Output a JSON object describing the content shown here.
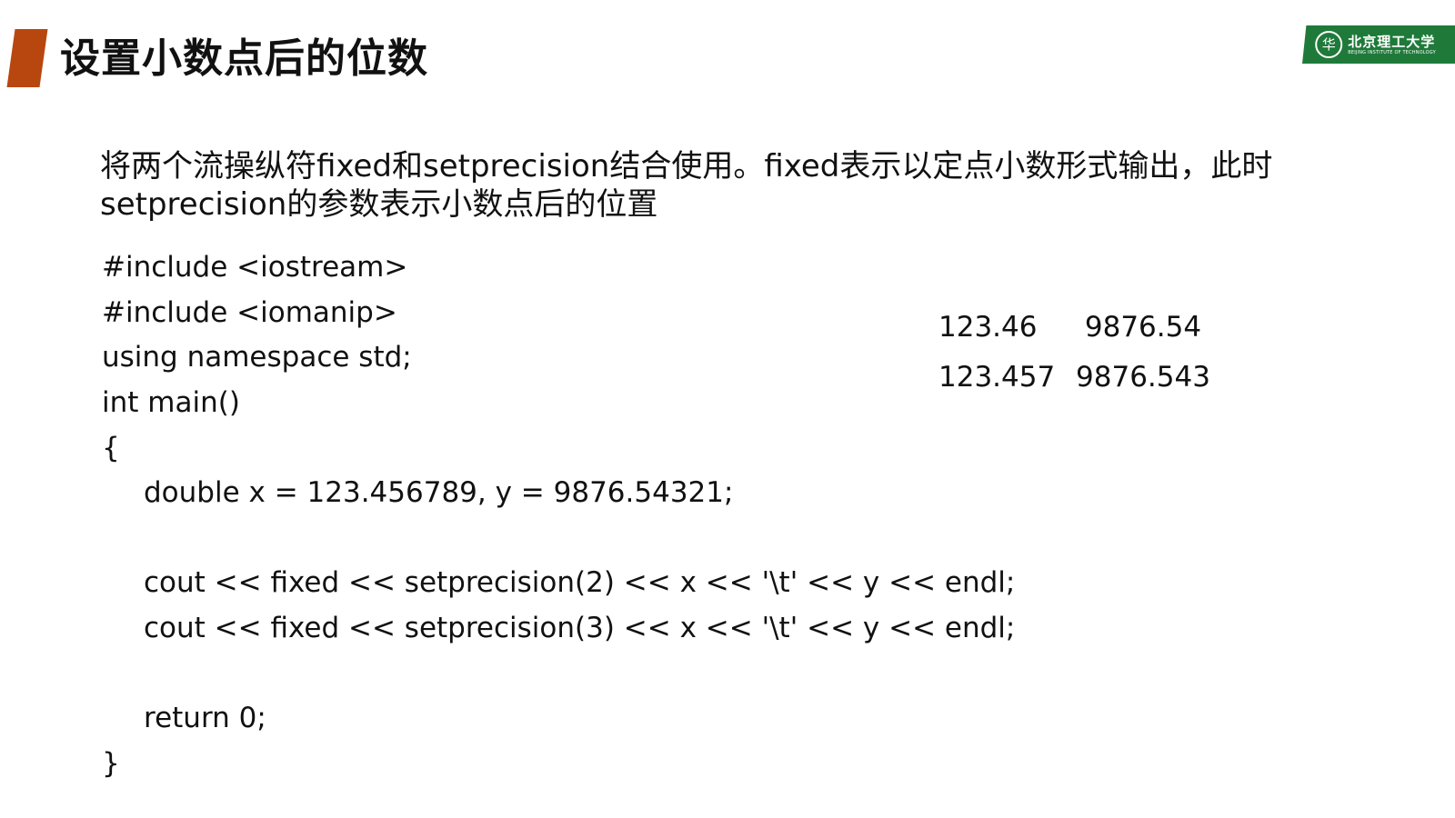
{
  "slide": {
    "title": "设置小数点后的位数",
    "logo": {
      "emblem_symbol": "华",
      "name_cn": "北京理工大学",
      "name_en": "BEIJING INSTITUTE OF TECHNOLOGY"
    },
    "description": "将两个流操纵符fixed和setprecision结合使用。fixed表示以定点小数形式输出，此时setprecision的参数表示小数点后的位置",
    "code_lines": [
      "#include <iostream>",
      "#include <iomanip>",
      "using namespace std;",
      "int main()",
      "{",
      "double x = 123.456789, y = 9876.54321;",
      "cout << fixed << setprecision(2) << x << '\\t' << y << endl;",
      "cout << fixed << setprecision(3) << x << '\\t' << y << endl;",
      "return 0;",
      "}"
    ],
    "output_rows": [
      {
        "x": "123.46",
        "y": "9876.54"
      },
      {
        "x": "123.457",
        "y": "9876.543"
      }
    ]
  },
  "colors": {
    "accent": "#b8470f",
    "logo_green": "#1f7a3a"
  }
}
